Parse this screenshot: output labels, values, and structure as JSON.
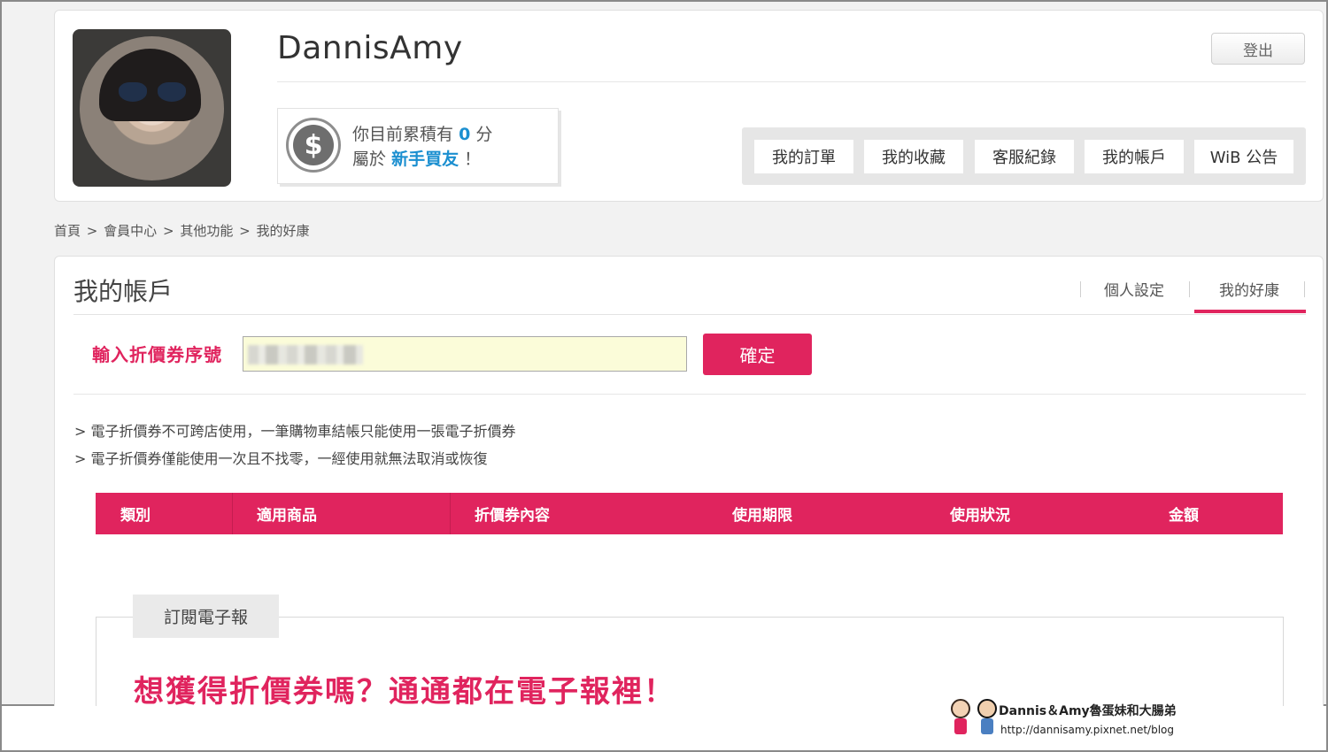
{
  "header": {
    "username": "DannisAmy",
    "logout_label": "登出",
    "points": {
      "line1_prefix": "你目前累積有",
      "points_value": "0",
      "line1_suffix": "分",
      "line2_prefix": "屬於",
      "member_level": "新手買友",
      "line2_suffix": "！"
    },
    "nav": [
      {
        "label": "我的訂單"
      },
      {
        "label": "我的收藏"
      },
      {
        "label": "客服紀錄"
      },
      {
        "label": "我的帳戶"
      },
      {
        "label": "WiB 公告"
      }
    ]
  },
  "breadcrumb": [
    "首頁",
    "會員中心",
    "其他功能",
    "我的好康"
  ],
  "breadcrumb_sep": ">",
  "account": {
    "title": "我的帳戶",
    "tabs": [
      {
        "label": "個人設定",
        "active": false
      },
      {
        "label": "我的好康",
        "active": true
      }
    ],
    "coupon_label": "輸入折價券序號",
    "confirm_label": "確定",
    "notes": [
      "> 電子折價券不可跨店使用，一筆購物車結帳只能使用一張電子折價券",
      "> 電子折價券僅能使用一次且不找零，一經使用就無法取消或恢復"
    ],
    "table_headers": [
      "類別",
      "適用商品",
      "折價券內容",
      "使用期限",
      "使用狀況",
      "金額"
    ]
  },
  "newsletter": {
    "tab_label": "訂閱電子報",
    "promo": "想獲得折價券嗎？通通都在電子報裡！"
  },
  "watermark": {
    "title": "Dannis＆Amy魯蛋妹和大腸弟",
    "url": "http://dannisamy.pixnet.net/blog"
  },
  "colors": {
    "accent": "#e0245e",
    "link_blue": "#1b8fd0"
  }
}
